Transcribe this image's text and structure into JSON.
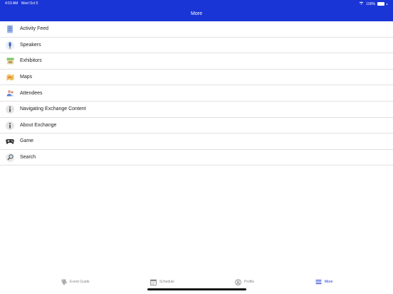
{
  "status": {
    "time": "4:53 AM",
    "date": "Wed Oct 5",
    "battery": "100%"
  },
  "header": {
    "title": "More"
  },
  "menu": [
    {
      "label": "Activity Feed",
      "icon": "activity-feed-icon"
    },
    {
      "label": "Speakers",
      "icon": "microphone-icon"
    },
    {
      "label": "Exhibitors",
      "icon": "exhibitors-booth-icon"
    },
    {
      "label": "Maps",
      "icon": "map-icon"
    },
    {
      "label": "Attendees",
      "icon": "attendees-icon"
    },
    {
      "label": "Navigating Exchange Content",
      "icon": "info-icon"
    },
    {
      "label": "About Exchange",
      "icon": "info-icon"
    },
    {
      "label": "Game",
      "icon": "gamepad-icon"
    },
    {
      "label": "Search",
      "icon": "search-icon"
    }
  ],
  "tabs": [
    {
      "label": "Event Guide",
      "icon": "event-guide-icon",
      "active": false
    },
    {
      "label": "Schedule",
      "icon": "calendar-icon",
      "active": false
    },
    {
      "label": "Profile",
      "icon": "profile-icon",
      "active": false
    },
    {
      "label": "More",
      "icon": "hamburger-menu-icon",
      "active": true
    }
  ],
  "colors": {
    "accent": "#1a35d6"
  }
}
